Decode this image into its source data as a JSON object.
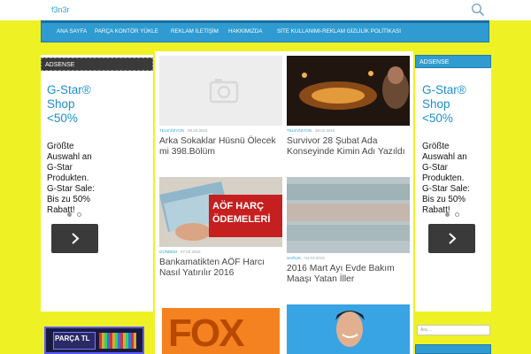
{
  "site": {
    "title": "f3n3r"
  },
  "nav": {
    "items": [
      "ANA SAYFA",
      "PARÇA KONTÖR YÜKLE",
      "REKLAM İLETİŞİM",
      "HAKKIMIZDA",
      "SİTE KULLANIMI-REKLAM GİZLİLİK POLİTİKASI"
    ]
  },
  "left_ad": {
    "title": "ADSENSE",
    "headline": [
      "G-Star®",
      "Shop",
      "<50%"
    ],
    "body": [
      "Größte",
      "Auswahl an",
      "G-Star",
      "Produkten.",
      "G-Star Sale:",
      "Bis zu 50%",
      "Rabatt!"
    ]
  },
  "right_ad": {
    "title": "ADSENSE",
    "headline": [
      "G-Star®",
      "Shop",
      "<50%"
    ],
    "body": [
      "Größte",
      "Auswahl an",
      "G-Star",
      "Produkten.",
      "G-Star Sale:",
      "Bis zu 50%",
      "Rabatt!"
    ]
  },
  "posts": [
    {
      "category": "TELEVİZYON",
      "date": "08.03.2016",
      "title_lines": [
        "Arka Sokaklar Hüsnü Ölecek",
        "mi 398.Bölüm"
      ]
    },
    {
      "category": "TELEVİZYON",
      "date": "28.02.2016",
      "title_lines": [
        "Survivor 28 Şubat Ada",
        "Konseyinde Kimin Adı Yazıldı"
      ]
    },
    {
      "category": "GÜNDEM",
      "date": "07.03.2016",
      "title_lines": [
        "Bankamatikten AÖF Harcı",
        "Nasıl Yatırılır 2016"
      ]
    },
    {
      "category": "SAĞLIK",
      "date": "04.03.2016",
      "title_lines": [
        "2016 Mart Ayı Evde Bakım",
        "Maaşı Yatan İller"
      ]
    }
  ],
  "images": {
    "aof_line1": "AÖF HARÇ",
    "aof_line2": "ÖDEMELERİ",
    "fox": "FOX",
    "parca": "PARÇA TL"
  },
  "search": {
    "placeholder": "Ara ..."
  },
  "colors": {
    "page_bg": "#eef225",
    "accent": "#2f9bd0",
    "ad_blue": "#1a8fd1"
  }
}
